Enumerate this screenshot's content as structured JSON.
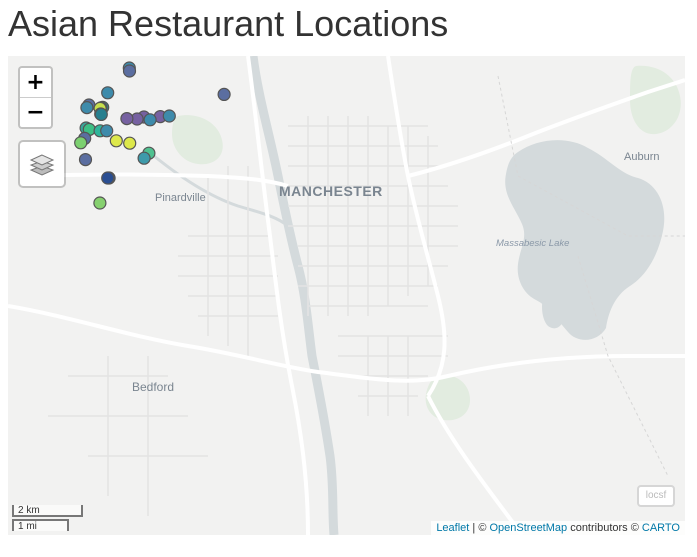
{
  "title": "Asian Restaurant Locations",
  "map": {
    "place_labels": {
      "manchester": "MANCHESTER",
      "pinardville": "Pinardville",
      "bedford": "Bedford",
      "auburn": "Auburn",
      "lake": "Massabesic Lake"
    },
    "zoom_in": "+",
    "zoom_out": "−",
    "layers_icon": "layers-icon",
    "scale": {
      "km": "2 km",
      "mi": "1 mi"
    },
    "minimap_toggle": "locsf",
    "attribution": {
      "leaflet": "Leaflet",
      "sep1": " | © ",
      "osm": "OpenStreetMap",
      "mid": " contributors © ",
      "carto": "CARTO"
    },
    "markers": [
      {
        "lat": 43.0308,
        "lon": -71.4448,
        "color": "#3e8bab"
      },
      {
        "lat": 43.0278,
        "lon": -71.4446,
        "color": "#5b6ea0"
      },
      {
        "lat": 43.006,
        "lon": -71.4664,
        "color": "#3e8bab"
      },
      {
        "lat": 43.0044,
        "lon": -71.35,
        "color": "#5b6ea0"
      },
      {
        "lat": 42.9956,
        "lon": -71.5448,
        "color": "#2fb59a"
      },
      {
        "lat": 42.9922,
        "lon": -71.5366,
        "color": "#a9d36a"
      },
      {
        "lat": 42.9908,
        "lon": -71.5338,
        "color": "#3dbf85"
      },
      {
        "lat": 42.9938,
        "lon": -71.4852,
        "color": "#5b6ea0"
      },
      {
        "lat": 42.9912,
        "lon": -71.4872,
        "color": "#3e8bab"
      },
      {
        "lat": 42.9914,
        "lon": -71.4714,
        "color": "#2e8a8f"
      },
      {
        "lat": 42.991,
        "lon": -71.4732,
        "color": "#1fa39a"
      },
      {
        "lat": 42.9904,
        "lon": -71.474,
        "color": "#c7df4e"
      },
      {
        "lat": 42.9848,
        "lon": -71.4734,
        "color": "#1b8f8f"
      },
      {
        "lat": 42.9844,
        "lon": -71.4728,
        "color": "#277f8e"
      },
      {
        "lat": 42.9818,
        "lon": -71.4302,
        "color": "#7661a1"
      },
      {
        "lat": 42.9822,
        "lon": -71.4138,
        "color": "#7661a1"
      },
      {
        "lat": 42.9798,
        "lon": -71.437,
        "color": "#7661a1"
      },
      {
        "lat": 42.9802,
        "lon": -71.4472,
        "color": "#7661a1"
      },
      {
        "lat": 42.979,
        "lon": -71.424,
        "color": "#3e8bab"
      },
      {
        "lat": 42.9828,
        "lon": -71.4048,
        "color": "#3e8bab"
      },
      {
        "lat": 42.9708,
        "lon": -71.488,
        "color": "#3aa69a"
      },
      {
        "lat": 42.9694,
        "lon": -71.4848,
        "color": "#3dbf85"
      },
      {
        "lat": 42.968,
        "lon": -71.474,
        "color": "#2fb59a"
      },
      {
        "lat": 42.968,
        "lon": -71.4674,
        "color": "#3e8bab"
      },
      {
        "lat": 42.9604,
        "lon": -71.4894,
        "color": "#5b6ea0"
      },
      {
        "lat": 42.956,
        "lon": -71.4934,
        "color": "#7cd070"
      },
      {
        "lat": 42.958,
        "lon": -71.4578,
        "color": "#dde84b"
      },
      {
        "lat": 42.9556,
        "lon": -71.4444,
        "color": "#dde84b"
      },
      {
        "lat": 42.9456,
        "lon": -71.4252,
        "color": "#4fc190"
      },
      {
        "lat": 42.9406,
        "lon": -71.43,
        "color": "#3e9aaa"
      },
      {
        "lat": 42.9392,
        "lon": -71.4886,
        "color": "#5b6ea0"
      },
      {
        "lat": 42.9208,
        "lon": -71.465,
        "color": "#3b5f9a"
      },
      {
        "lat": 42.9208,
        "lon": -71.4664,
        "color": "#2a4e92"
      },
      {
        "lat": 42.8958,
        "lon": -71.4742,
        "color": "#86d06f"
      }
    ]
  }
}
